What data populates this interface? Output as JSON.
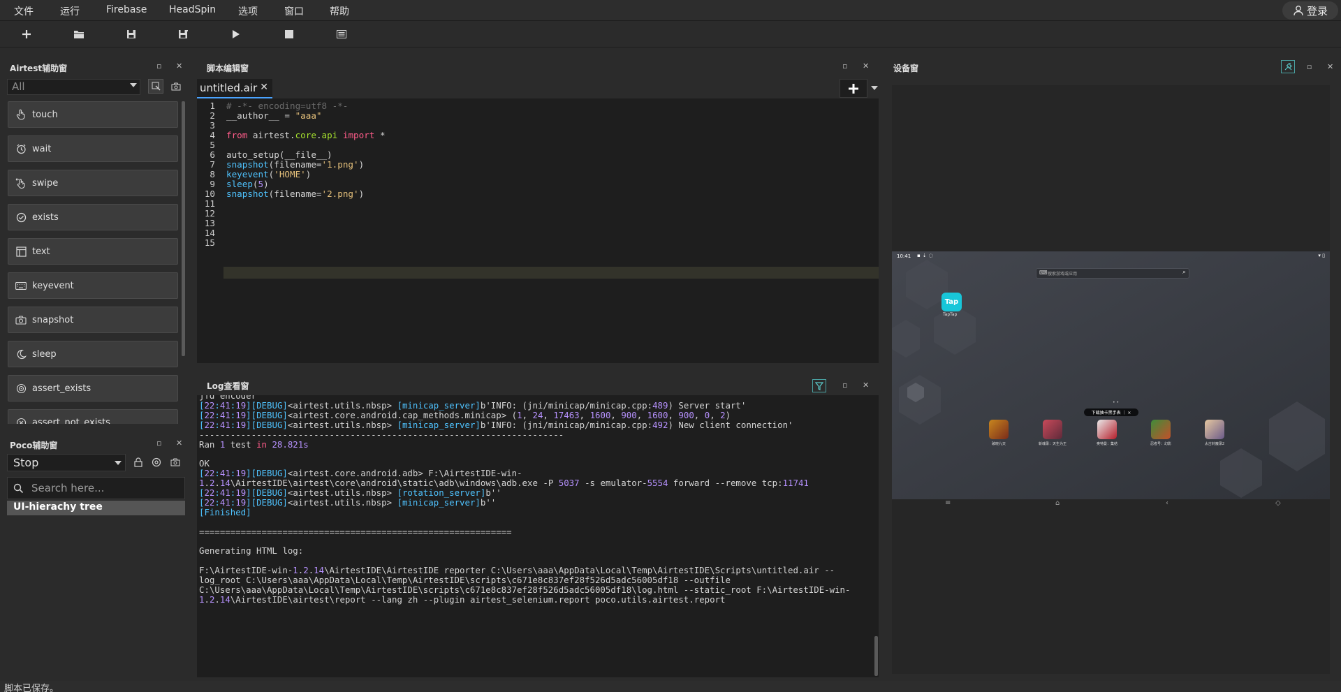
{
  "menu": [
    "文件",
    "运行",
    "Firebase",
    "HeadSpin",
    "选项",
    "窗口",
    "帮助"
  ],
  "login_label": "登录",
  "toolbar_icons": [
    "new-file-icon",
    "open-folder-icon",
    "save-icon",
    "save-as-icon",
    "run-icon",
    "stop-icon",
    "log-view-icon"
  ],
  "airtest_panel": {
    "title": "Airtest辅助窗",
    "filter_value": "All",
    "buttons": [
      {
        "label": "touch",
        "icon": "touch-icon"
      },
      {
        "label": "wait",
        "icon": "clock-icon"
      },
      {
        "label": "swipe",
        "icon": "swipe-icon"
      },
      {
        "label": "exists",
        "icon": "check-circle-icon"
      },
      {
        "label": "text",
        "icon": "text-icon"
      },
      {
        "label": "keyevent",
        "icon": "keyboard-icon"
      },
      {
        "label": "snapshot",
        "icon": "camera-icon"
      },
      {
        "label": "sleep",
        "icon": "moon-icon"
      },
      {
        "label": "assert_exists",
        "icon": "target-icon"
      },
      {
        "label": "assert_not_exists",
        "icon": "target-x-icon"
      }
    ]
  },
  "poco_panel": {
    "title": "Poco辅助窗",
    "mode_value": "Stop",
    "search_placeholder": "Search here...",
    "tree_root": "UI-hierachy tree"
  },
  "editor_panel": {
    "title": "脚本编辑窗",
    "tab_name": "untitled.air",
    "lines": [
      "# -*- encoding=utf8 -*-",
      "__author__ = \"aaa\"",
      "",
      "from airtest.core.api import *",
      "",
      "auto_setup(__file__)",
      "snapshot(filename='1.png')",
      "keyevent('HOME')",
      "sleep(5)",
      "snapshot(filename='2.png')",
      "",
      "",
      "",
      "",
      ""
    ]
  },
  "log_panel": {
    "title": "Log查看窗",
    "lines": [
      "jfd encoder",
      "[22:41:19][DEBUG]<airtest.utils.nbsp> [minicap_server]b'INFO: (jni/minicap/minicap.cpp:489) Server start'",
      "[22:41:19][DEBUG]<airtest.core.android.cap_methods.minicap> (1, 24, 17463, 1600, 900, 1600, 900, 0, 2)",
      "[22:41:19][DEBUG]<airtest.utils.nbsp> [minicap_server]b'INFO: (jni/minicap/minicap.cpp:492) New client connection'",
      "----------------------------------------------------------------------",
      "Ran 1 test in 28.821s",
      "",
      "OK",
      "[22:41:19][DEBUG]<airtest.core.android.adb> F:\\AirtestIDE-win-",
      "1.2.14\\AirtestIDE\\airtest\\core\\android\\static\\adb\\windows\\adb.exe -P 5037 -s emulator-5554 forward --remove tcp:11741",
      "[22:41:19][DEBUG]<airtest.utils.nbsp> [rotation_server]b''",
      "[22:41:19][DEBUG]<airtest.utils.nbsp> [minicap_server]b''",
      "[Finished]",
      "",
      "============================================================",
      "",
      "Generating HTML log:",
      "",
      "F:\\AirtestIDE-win-1.2.14\\AirtestIDE\\AirtestIDE reporter C:\\Users\\aaa\\AppData\\Local\\Temp\\AirtestIDE\\Scripts\\untitled.air --",
      "log_root C:\\Users\\aaa\\AppData\\Local\\Temp\\AirtestIDE\\scripts\\c671e8c837ef28f526d5adc56005df18 --outfile",
      "C:\\Users\\aaa\\AppData\\Local\\Temp\\AirtestIDE\\scripts\\c671e8c837ef28f526d5adc56005df18\\log.html --static_root F:\\AirtestIDE-win-",
      "1.2.14\\AirtestIDE\\airtest\\report --lang zh --plugin airtest_selenium.report poco.utils.airtest.report"
    ]
  },
  "device_panel": {
    "title": "设备窗",
    "time": "10:41",
    "search_placeholder": "搜索游戏或应用",
    "app_icon_label": "Tap",
    "app_name": "TapTap",
    "banner": "下载抽卡黑手表 ｜ ×",
    "dock_apps": [
      "破晓九天",
      "斩魂录：天生为王",
      "奥特曼：集结",
      "忍者号：幻影",
      "太古封魔录2"
    ]
  },
  "status_text": "脚本已保存。"
}
